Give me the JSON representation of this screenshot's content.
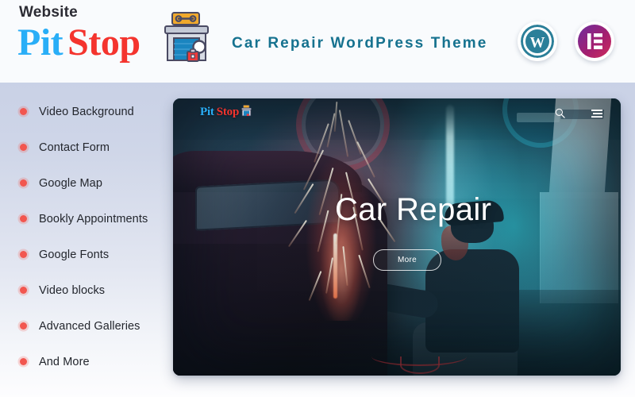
{
  "header": {
    "eyebrow": "Website",
    "brand_first": "Pit",
    "brand_second": "Stop",
    "tagline": "Car Repair WordPress Theme",
    "brand_first_color": "#29aef7",
    "brand_second_color": "#f4342e",
    "tagline_color": "#16728f",
    "logo_icon": "garage-wrench-icon",
    "badges": [
      {
        "name": "wordpress-badge",
        "icon": "wordpress-icon",
        "color": "#21759b"
      },
      {
        "name": "elementor-badge",
        "icon": "elementor-icon",
        "color": "#a3206f"
      }
    ]
  },
  "features": {
    "bullet_color": "#f2564f",
    "items": [
      {
        "label": "Video Background"
      },
      {
        "label": "Contact Form"
      },
      {
        "label": "Google Map"
      },
      {
        "label": "Bookly Appointments"
      },
      {
        "label": "Google Fonts"
      },
      {
        "label": "Video blocks"
      },
      {
        "label": "Advanced Galleries"
      },
      {
        "label": "And More"
      }
    ]
  },
  "preview": {
    "site_logo_first": "Pit",
    "site_logo_second": "Stop",
    "site_logo_icon": "garage-wrench-icon",
    "nav_icons": [
      {
        "name": "search-icon"
      },
      {
        "name": "hamburger-menu-icon"
      }
    ],
    "hero_title": "Car Repair",
    "hero_button": "More",
    "scene_description": "mechanic grinding metal with sparks in a teal-lit garage behind a dark car"
  }
}
